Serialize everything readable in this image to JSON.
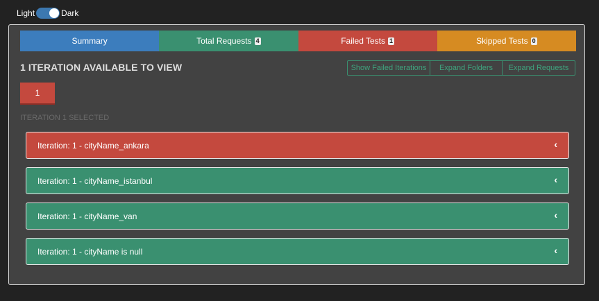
{
  "theme": {
    "light_label": "Light",
    "dark_label": "Dark"
  },
  "tabs": [
    {
      "label": "Summary",
      "badge": ""
    },
    {
      "label": "Total Requests",
      "badge": "4"
    },
    {
      "label": "Failed Tests",
      "badge": "1"
    },
    {
      "label": "Skipped Tests",
      "badge": "0"
    }
  ],
  "heading": "1 ITERATION AVAILABLE TO VIEW",
  "actions": {
    "show_failed": "Show Failed Iterations",
    "expand_folders": "Expand Folders",
    "expand_requests": "Expand Requests"
  },
  "iteration_button": "1",
  "selected_label": "ITERATION 1 SELECTED",
  "iterations": [
    {
      "label": "Iteration: 1 - cityName_ankara",
      "status": "failed"
    },
    {
      "label": "Iteration: 1 - cityName_istanbul",
      "status": "passed"
    },
    {
      "label": "Iteration: 1 - cityName_van",
      "status": "passed"
    },
    {
      "label": "Iteration: 1 - cityName is null",
      "status": "passed"
    }
  ],
  "colors": {
    "summary": "#3c7dbd",
    "passed": "#3a9070",
    "failed": "#c4493e",
    "skipped": "#d68b22",
    "background": "#222222",
    "card": "#424242"
  },
  "icons": {
    "row_toggle": "chevron-left-icon"
  }
}
